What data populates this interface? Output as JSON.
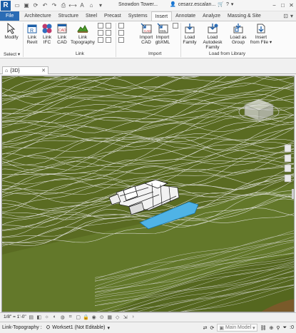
{
  "app": {
    "letter": "R"
  },
  "title_bar": {
    "document_title": "Snowdon Tower...",
    "user_name": "cesarz.escalan...",
    "help": "?"
  },
  "tabs": [
    "File",
    "Architecture",
    "Structure",
    "Steel",
    "Precast",
    "Systems",
    "Insert",
    "Annotate",
    "Analyze",
    "Massing & Site"
  ],
  "active_tab": "Insert",
  "ribbon": {
    "select": {
      "button": "Modify",
      "panel": "Select"
    },
    "link_panel": {
      "label": "Link",
      "buttons": [
        {
          "line1": "Link",
          "line2": "Revit"
        },
        {
          "line1": "Link",
          "line2": "IFC"
        },
        {
          "line1": "Link",
          "line2": "CAD"
        },
        {
          "line1": "Link",
          "line2": "Topography"
        }
      ]
    },
    "import_panel": {
      "label": "Import",
      "buttons": [
        {
          "line1": "Import",
          "line2": "CAD"
        },
        {
          "line1": "Import",
          "line2": "gbXML"
        }
      ]
    },
    "library_panel": {
      "label": "Load from Library",
      "buttons": [
        {
          "line1": "Load",
          "line2": "Family"
        },
        {
          "line1": "Load Autodesk",
          "line2": "Family"
        },
        {
          "line1": "Load as",
          "line2": "Group"
        },
        {
          "line1": "Insert",
          "line2": "from File"
        }
      ]
    }
  },
  "view_tab": {
    "label": "{3D}"
  },
  "view_bar": {
    "scale": "1/8\" = 1'-0\""
  },
  "status_bar": {
    "selection": "Link-Topography :",
    "workset": "Workset1 (Not Editable)",
    "model": "Main Model",
    "filter_count": ":0"
  },
  "colors": {
    "file_tab": "#2b6cb5",
    "terrain": "#5a6b22",
    "contour": "#e8e8e8",
    "water_feature": "#4fb3e6"
  }
}
